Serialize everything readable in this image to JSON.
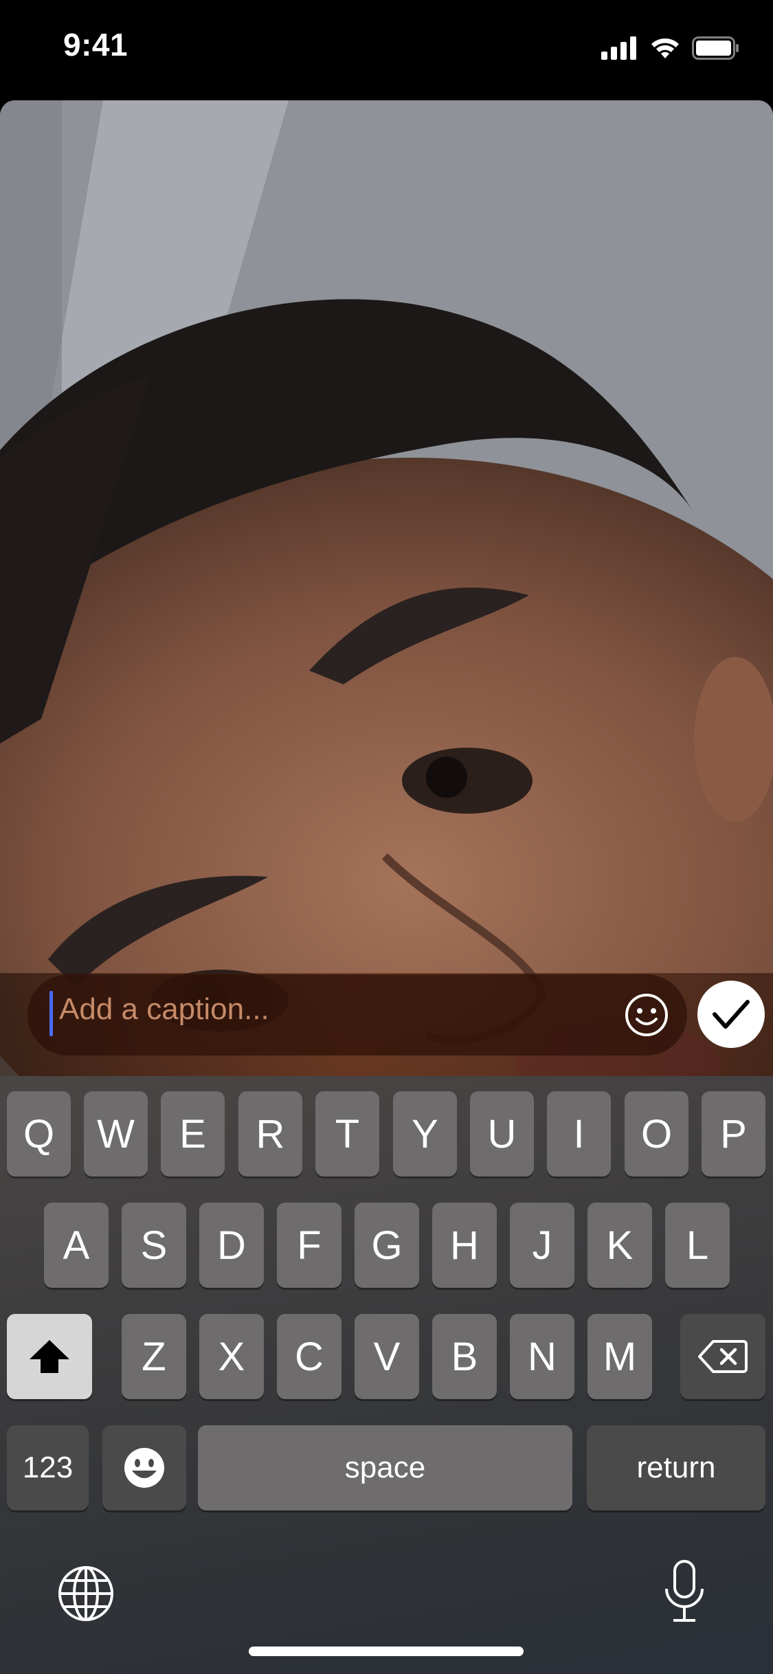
{
  "status_bar": {
    "time": "9:41"
  },
  "caption": {
    "placeholder": "Add a caption..."
  },
  "keyboard": {
    "row1": [
      "Q",
      "W",
      "E",
      "R",
      "T",
      "Y",
      "U",
      "I",
      "O",
      "P"
    ],
    "row2": [
      "A",
      "S",
      "D",
      "F",
      "G",
      "H",
      "J",
      "K",
      "L"
    ],
    "row3": [
      "Z",
      "X",
      "C",
      "V",
      "B",
      "N",
      "M"
    ],
    "numbers_label": "123",
    "space_label": "space",
    "return_label": "return"
  },
  "icons": {
    "signal": "cellular-signal-icon",
    "wifi": "wifi-icon",
    "battery": "battery-icon",
    "emoji": "smiley-icon",
    "send": "checkmark-icon",
    "shift": "shift-arrow-icon",
    "delete": "backspace-icon",
    "globe": "globe-icon",
    "mic": "microphone-icon"
  },
  "colors": {
    "cursor": "#4a6cff",
    "caption_placeholder": "#c58a68"
  }
}
